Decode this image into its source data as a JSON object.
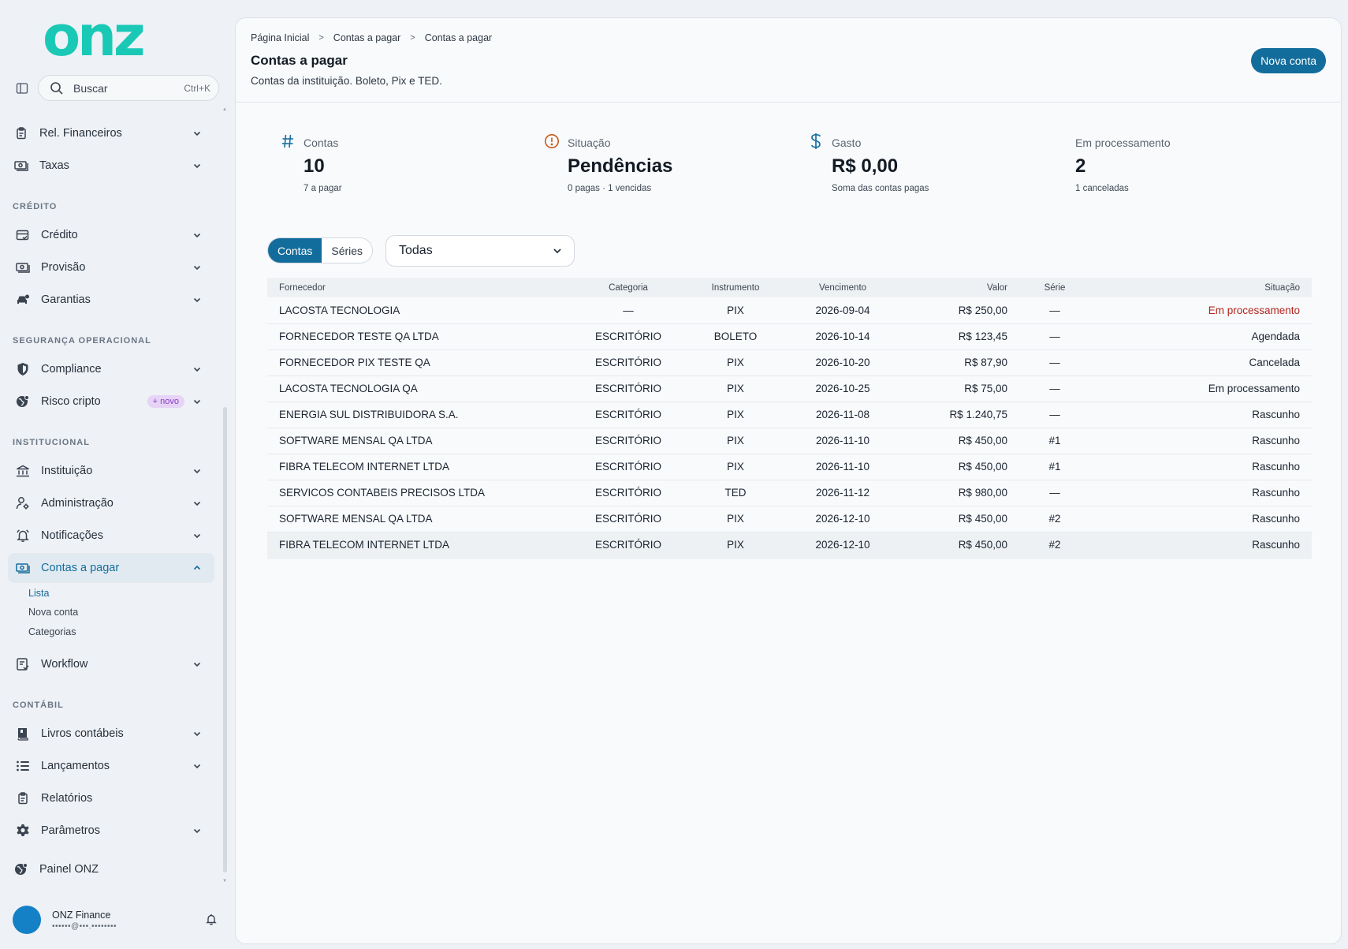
{
  "brand": {
    "logo_text": "onz",
    "accent": "#19c9b6",
    "primary": "#136d9c"
  },
  "search": {
    "label": "Buscar",
    "shortcut": "Ctrl+K"
  },
  "nav": {
    "rel_financeiros": "Rel. Financeiros",
    "taxas": "Taxas",
    "section_credito": "CRÉDITO",
    "credito": "Crédito",
    "provisao": "Provisão",
    "garantias": "Garantias",
    "section_seguranca": "SEGURANÇA OPERACIONAL",
    "compliance": "Compliance",
    "risco_cripto": "Risco cripto",
    "risco_badge": "+ novo",
    "section_institucional": "INSTITUCIONAL",
    "instituicao": "Instituição",
    "administracao": "Administração",
    "notificacoes": "Notificações",
    "contas_a_pagar": "Contas a pagar",
    "sub_lista": "Lista",
    "sub_nova_conta": "Nova conta",
    "sub_categorias": "Categorias",
    "workflow": "Workflow",
    "section_contabil": "CONTÁBIL",
    "livros_contabeis": "Livros contábeis",
    "lancamentos": "Lançamentos",
    "relatorios": "Relatórios",
    "parametros": "Parâmetros",
    "painel_onz": "Painel ONZ"
  },
  "user": {
    "name": "ONZ Finance",
    "email": "••••••@•••.••••••••"
  },
  "header": {
    "breadcrumb": [
      "Página Inicial",
      "Contas a pagar",
      "Contas a pagar"
    ],
    "title": "Contas a pagar",
    "subtitle": "Contas da instituição. Boleto, Pix e TED.",
    "new_button": "Nova conta"
  },
  "stats": [
    {
      "label": "Contas",
      "value": "10",
      "hint": "7 a pagar",
      "icon": "hash-icon"
    },
    {
      "label": "Situação",
      "value": "Pendências",
      "hint": "0 pagas · 1 vencidas",
      "icon": "alert-circle-icon"
    },
    {
      "label": "Gasto",
      "value": "R$ 0,00",
      "hint": "Soma das contas pagas",
      "icon": "dollar-icon"
    },
    {
      "label": "Em processamento",
      "value": "2",
      "hint": "1 canceladas"
    }
  ],
  "tabs": {
    "contas": "Contas",
    "series": "Séries"
  },
  "filter": {
    "selected": "Todas"
  },
  "table": {
    "columns": [
      "Fornecedor",
      "Categoria",
      "Instrumento",
      "Vencimento",
      "Valor",
      "Série",
      "Situação"
    ],
    "rows": [
      {
        "fornecedor": "LACOSTA TECNOLOGIA",
        "categoria": "—",
        "instrumento": "PIX",
        "vencimento": "2026-09-04",
        "valor": "R$ 250,00",
        "serie": "—",
        "situacao": "Em processamento"
      },
      {
        "fornecedor": "FORNECEDOR TESTE QA LTDA",
        "categoria": "ESCRITÓRIO",
        "instrumento": "BOLETO",
        "vencimento": "2026-10-14",
        "valor": "R$ 123,45",
        "serie": "—",
        "situacao": "Agendada"
      },
      {
        "fornecedor": "FORNECEDOR PIX TESTE QA",
        "categoria": "ESCRITÓRIO",
        "instrumento": "PIX",
        "vencimento": "2026-10-20",
        "valor": "R$ 87,90",
        "serie": "—",
        "situacao": "Cancelada"
      },
      {
        "fornecedor": "LACOSTA TECNOLOGIA QA",
        "categoria": "ESCRITÓRIO",
        "instrumento": "PIX",
        "vencimento": "2026-10-25",
        "valor": "R$ 75,00",
        "serie": "—",
        "situacao": "Em processamento"
      },
      {
        "fornecedor": "ENERGIA SUL DISTRIBUIDORA S.A.",
        "categoria": "ESCRITÓRIO",
        "instrumento": "PIX",
        "vencimento": "2026-11-08",
        "valor": "R$ 1.240,75",
        "serie": "—",
        "situacao": "Rascunho"
      },
      {
        "fornecedor": "SOFTWARE MENSAL QA LTDA",
        "categoria": "ESCRITÓRIO",
        "instrumento": "PIX",
        "vencimento": "2026-11-10",
        "valor": "R$ 450,00",
        "serie": "#1",
        "situacao": "Rascunho"
      },
      {
        "fornecedor": "FIBRA TELECOM INTERNET LTDA",
        "categoria": "ESCRITÓRIO",
        "instrumento": "PIX",
        "vencimento": "2026-11-10",
        "valor": "R$ 450,00",
        "serie": "#1",
        "situacao": "Rascunho"
      },
      {
        "fornecedor": "SERVICOS CONTABEIS PRECISOS LTDA",
        "categoria": "ESCRITÓRIO",
        "instrumento": "TED",
        "vencimento": "2026-11-12",
        "valor": "R$ 980,00",
        "serie": "—",
        "situacao": "Rascunho"
      },
      {
        "fornecedor": "SOFTWARE MENSAL QA LTDA",
        "categoria": "ESCRITÓRIO",
        "instrumento": "PIX",
        "vencimento": "2026-12-10",
        "valor": "R$ 450,00",
        "serie": "#2",
        "situacao": "Rascunho"
      },
      {
        "fornecedor": "FIBRA TELECOM INTERNET LTDA",
        "categoria": "ESCRITÓRIO",
        "instrumento": "PIX",
        "vencimento": "2026-12-10",
        "valor": "R$ 450,00",
        "serie": "#2",
        "situacao": "Rascunho"
      }
    ]
  }
}
